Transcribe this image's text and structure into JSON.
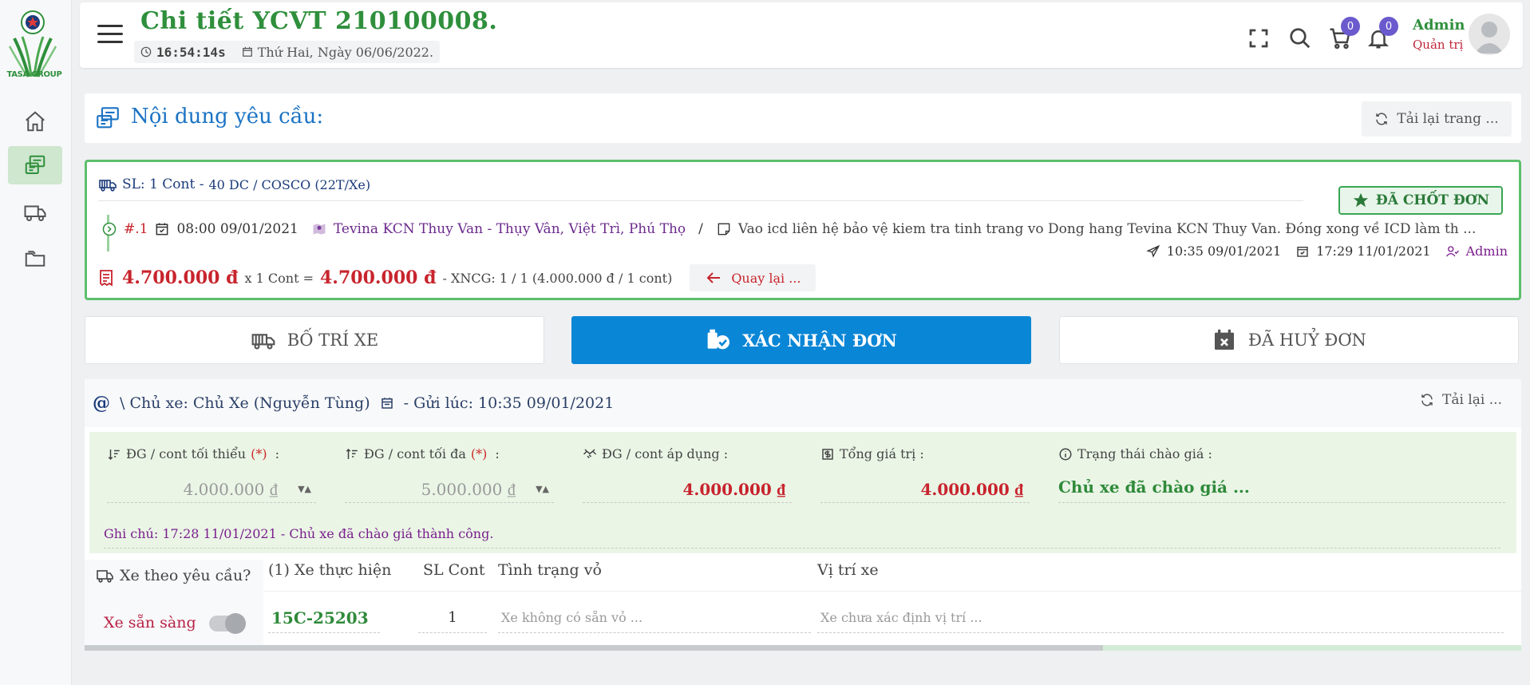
{
  "sidebar": {
    "logo_text": "TASA GROUP",
    "items": [
      "home-icon",
      "order-icon",
      "truck-icon",
      "folder-icon"
    ]
  },
  "header": {
    "title": "Chi tiết YCVT 210100008.",
    "time": "16:54:14s",
    "date": "Thứ Hai, Ngày 06/06/2022.",
    "cart_count": "0",
    "notify_count": "0",
    "user_name": "Admin",
    "user_role": "Quản trị"
  },
  "section": {
    "title": "Nội dung yêu cầu:",
    "reload": "Tải lại trang ..."
  },
  "order": {
    "qty_label": "SL: 1 Cont -",
    "qty_detail": "40 DC / COSCO (22T/Xe)",
    "status": "ĐÃ CHỐT ĐƠN",
    "index": "#.1",
    "pickup_time": "08:00 09/01/2021",
    "location": "Tevina KCN Thuy Van - Thụy Vân, Việt Trì, Phú Thọ",
    "slash": "/",
    "note": "Vao icd liên hệ bảo vệ kiem tra tinh trang vo Dong hang Tevina KCN Thuy Van. Đóng xong về ICD làm th ...",
    "sent_time": "10:35 09/01/2021",
    "confirm_time": "17:29 11/01/2021",
    "by": "Admin",
    "unit_price": "4.700.000 đ",
    "times": "x 1 Cont =",
    "total": "4.700.000 đ",
    "xncg": "- XNCG: 1 / 1 (4.000.000 đ / 1 cont)",
    "back": "Quay lại ..."
  },
  "tabs": [
    {
      "label": "BỐ TRÍ XE"
    },
    {
      "label": "XÁC NHẬN ĐƠN"
    },
    {
      "label": "ĐÃ HUỶ ĐƠN"
    }
  ],
  "quote": {
    "at": "@",
    "owner": "\\ Chủ xe: Chủ Xe (Nguyễn Tùng)",
    "sent": "- Gửi lúc: 10:35 09/01/2021",
    "reload": "Tải lại ...",
    "min_label": "ĐG / cont tối thiểu",
    "min_value": "4.000.000 ₫",
    "max_label": "ĐG / cont tối đa",
    "max_value": "5.000.000 ₫",
    "req_mark": "(*)",
    "colon": ":",
    "apply_label": "ĐG / cont áp dụng :",
    "apply_value": "4.000.000 ₫",
    "total_label": "Tổng giá trị :",
    "total_value": "4.000.000 ₫",
    "state_label": "Trạng thái chào giá :",
    "state_value": "Chủ xe đã chào giá ...",
    "note": "Ghi chú: 17:28 11/01/2021 - Chủ xe đã chào giá thành công."
  },
  "table": {
    "req_header": "Xe theo yêu cầu?",
    "ready": "Xe sẵn sàng",
    "columns": [
      "(1) Xe thực hiện",
      "SL Cont",
      "Tình trạng vỏ",
      "Vị trí xe"
    ],
    "row": {
      "plate": "15C-25203",
      "qty": "1",
      "shell_placeholder": "Xe không có sẵn vỏ ...",
      "location_placeholder": "Xe chưa xác định vị trí ..."
    }
  },
  "colors": {
    "primary_green": "#2f8f3c",
    "accent_blue": "#0a86d6",
    "price_red": "#c8242d",
    "badge_purple": "#6a5acd"
  }
}
